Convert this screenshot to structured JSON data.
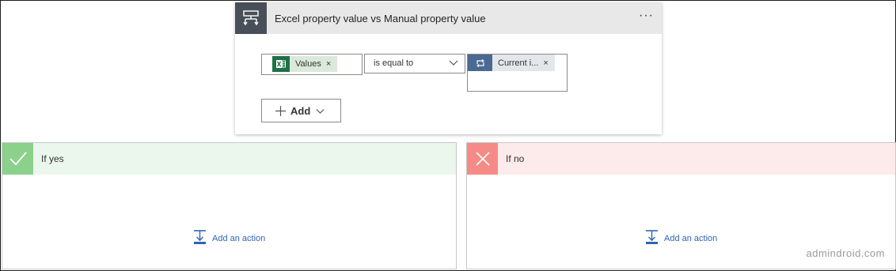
{
  "condition": {
    "title": "Excel property value vs Manual property value",
    "more_label": "···",
    "left_token": {
      "label": "Values",
      "icon": "excel-icon",
      "remove": "×"
    },
    "operator": {
      "selected": "is equal to"
    },
    "right_token": {
      "label": "Current i...",
      "icon": "loop-icon",
      "remove": "×"
    },
    "add_label": "Add"
  },
  "branches": {
    "yes": {
      "label": "If yes",
      "action": "Add an action",
      "color": "#8bd18b"
    },
    "no": {
      "label": "If no",
      "action": "Add an action",
      "color": "#f58b87"
    }
  },
  "watermark": "admindroid.com"
}
